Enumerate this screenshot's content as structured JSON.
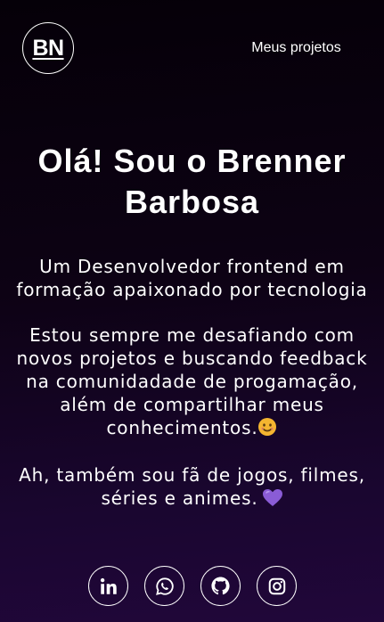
{
  "header": {
    "logo_text": "BN",
    "nav_link": "Meus projetos"
  },
  "hero": {
    "title": "Olá! Sou o Brenner Barbosa",
    "subtitle": "Um Desenvolvedor frontend em formação apaixonado por tecnologia",
    "paragraph_2": "Estou sempre me desafiando com novos projetos e buscando feedback na comunidadade de progamação, além de compartilhar meus conhecimentos.",
    "paragraph_2_emoji": "smiling-face-emoji",
    "paragraph_3": "Ah, também sou fã de jogos, filmes, séries e animes.",
    "paragraph_3_emoji": "purple-heart-emoji"
  },
  "socials": [
    {
      "icon": "linkedin-icon"
    },
    {
      "icon": "whatsapp-icon"
    },
    {
      "icon": "github-icon"
    },
    {
      "icon": "instagram-icon"
    }
  ],
  "colors": {
    "background_top": "#050008",
    "background_bottom": "#21073a",
    "text": "#ffffff",
    "heart": "#8a5cd6",
    "smile": "#f4b530"
  }
}
